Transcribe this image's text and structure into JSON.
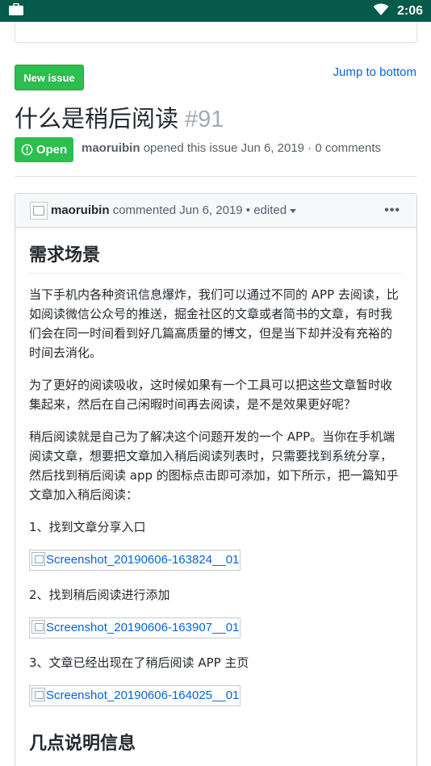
{
  "statusbar": {
    "time": "2:06"
  },
  "toolbar": {
    "new_issue_label": "New issue",
    "jump_label": "Jump to bottom"
  },
  "issue": {
    "title": "什么是稍后阅读",
    "number": "#91",
    "state": "Open",
    "author": "maoruibin",
    "meta_text": "opened this issue Jun 6, 2019 · 0 comments"
  },
  "comment": {
    "author": "maoruibin",
    "meta_text": "commented Jun 6, 2019 • edited",
    "more_label": "•••",
    "heading1": "需求场景",
    "para1": "当下手机内各种资讯信息爆炸，我们可以通过不同的 APP 去阅读，比如阅读微信公众号的推送，掘金社区的文章或者简书的文章，有时我们会在同一时间看到好几篇高质量的博文，但是当下却并没有充裕的时间去消化。",
    "para2": "为了更好的阅读吸收，这时候如果有一个工具可以把这些文章暂时收集起来，然后在自己闲暇时间再去阅读，是不是效果更好呢？",
    "para3": "稍后阅读就是自己为了解决这个问题开发的一个 APP。当你在手机端阅读文章，想要把文章加入稍后阅读列表时，只需要找到系统分享，然后找到稍后阅读 app 的图标点击即可添加，如下所示，把一篇知乎文章加入稍后阅读：",
    "step1": "1、找到文章分享入口",
    "img1": "Screenshot_20190606-163824__01",
    "step2": "2、找到稍后阅读进行添加",
    "img2": "Screenshot_20190606-163907__01",
    "step3": "3、文章已经出现在了稍后阅读 APP 主页",
    "img3": "Screenshot_20190606-164025__01",
    "heading2": "几点说明信息"
  },
  "colors": {
    "statusbar": "#055a4c",
    "green": "#2cbe4e",
    "link": "#0366d6"
  }
}
